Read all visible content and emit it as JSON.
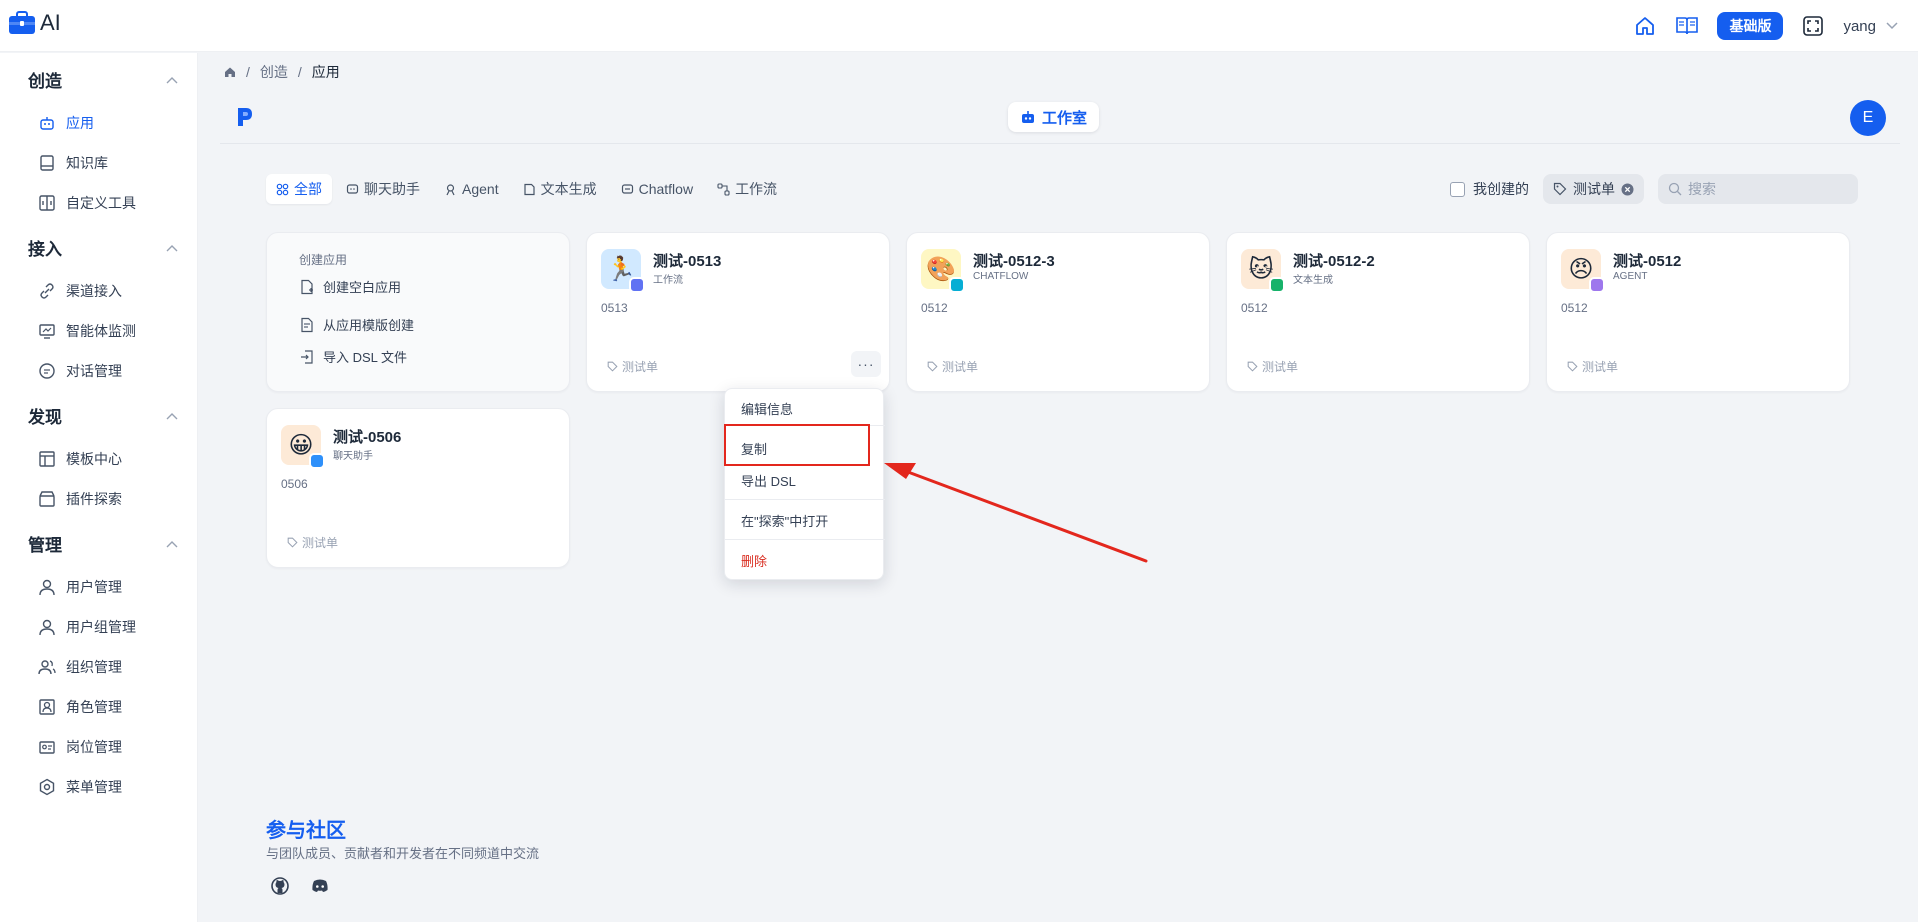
{
  "app": {
    "logo_text": "AI"
  },
  "topbar": {
    "plan_badge": "基础版",
    "username": "yang"
  },
  "sidebar": {
    "sections": [
      {
        "label": "创造",
        "items": [
          {
            "label": "应用",
            "active": true
          },
          {
            "label": "知识库"
          },
          {
            "label": "自定义工具"
          }
        ]
      },
      {
        "label": "接入",
        "items": [
          {
            "label": "渠道接入"
          },
          {
            "label": "智能体监测"
          },
          {
            "label": "对话管理"
          }
        ]
      },
      {
        "label": "发现",
        "items": [
          {
            "label": "模板中心"
          },
          {
            "label": "插件探索"
          }
        ]
      },
      {
        "label": "管理",
        "items": [
          {
            "label": "用户管理"
          },
          {
            "label": "用户组管理"
          },
          {
            "label": "组织管理"
          },
          {
            "label": "角色管理"
          },
          {
            "label": "岗位管理"
          },
          {
            "label": "菜单管理"
          }
        ]
      }
    ]
  },
  "breadcrumb": {
    "level1": "创造",
    "level2": "应用"
  },
  "studio": {
    "label": "工作室",
    "avatar": "E"
  },
  "tabs": [
    {
      "label": "全部"
    },
    {
      "label": "聊天助手"
    },
    {
      "label": "Agent"
    },
    {
      "label": "文本生成"
    },
    {
      "label": "Chatflow"
    },
    {
      "label": "工作流"
    }
  ],
  "filters": {
    "mine_label": "我创建的",
    "tag_label": "测试单",
    "search_placeholder": "搜索"
  },
  "create_card": {
    "title": "创建应用",
    "blank": "创建空白应用",
    "template": "从应用模版创建",
    "import": "导入 DSL 文件"
  },
  "apps": [
    {
      "name": "测试-0513",
      "type": "工作流",
      "desc": "0513",
      "tag": "测试单",
      "emoji": "🏃",
      "bg": "#d1e9ff",
      "badge": "#6172f3"
    },
    {
      "name": "测试-0512-3",
      "type": "CHATFLOW",
      "desc": "0512",
      "tag": "测试单",
      "emoji": "🎨",
      "bg": "#fef7c3",
      "badge": "#06aed4"
    },
    {
      "name": "测试-0512-2",
      "type": "文本生成",
      "desc": "0512",
      "tag": "测试单",
      "emoji": "🐱",
      "bg": "#fdead7",
      "badge": "#17b26a"
    },
    {
      "name": "测试-0512",
      "type": "AGENT",
      "desc": "0512",
      "tag": "测试单",
      "emoji": "😠",
      "bg": "#fdead7",
      "badge": "#9e77ed"
    },
    {
      "name": "测试-0506",
      "type": "聊天助手",
      "desc": "0506",
      "tag": "测试单",
      "emoji": "😀",
      "bg": "#fdead7",
      "badge": "#2e90fa"
    }
  ],
  "menu": {
    "edit": "编辑信息",
    "copy": "复制",
    "export": "导出 DSL",
    "open_explore": "在\"探索\"中打开",
    "delete": "删除"
  },
  "community": {
    "title": "参与社区",
    "desc": "与团队成员、贡献者和开发者在不同频道中交流"
  },
  "colors": {
    "accent": "#155eef",
    "danger": "#d92d20",
    "annotation": "#e3271d"
  }
}
